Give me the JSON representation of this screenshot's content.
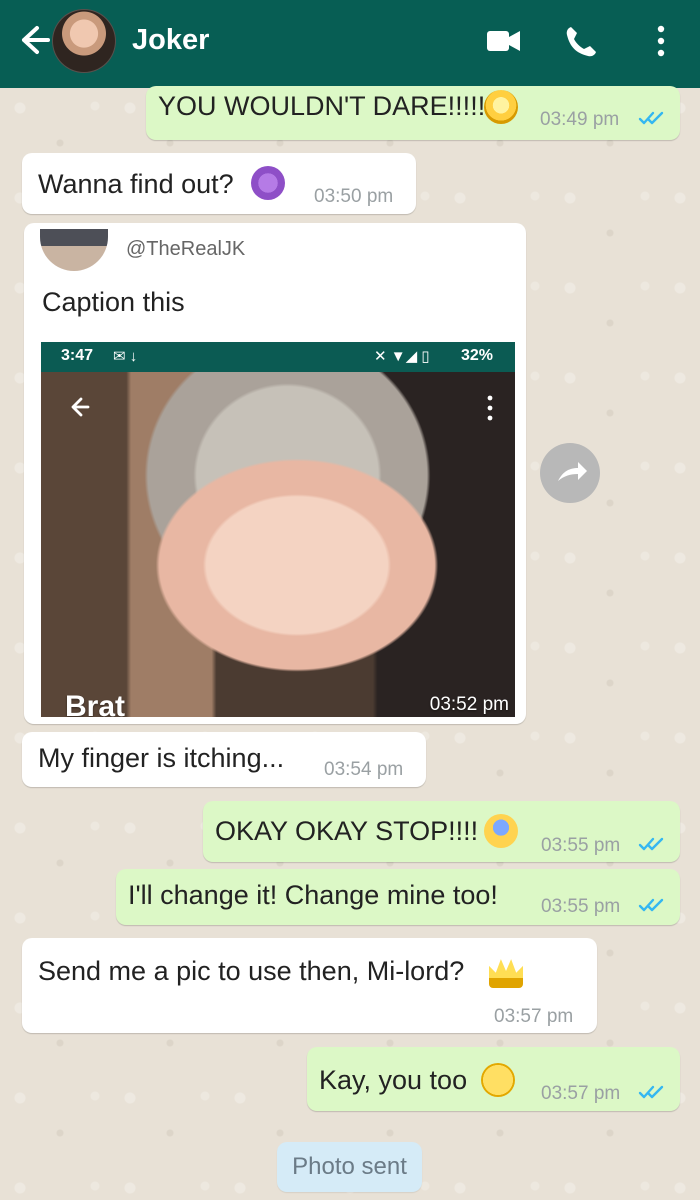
{
  "header": {
    "contact_name": "Joker",
    "back_icon": "back-arrow-icon",
    "video_icon": "video-call-icon",
    "call_icon": "phone-call-icon",
    "menu_icon": "more-options-icon",
    "brand_color": "#075e54"
  },
  "messages": [
    {
      "direction": "outgoing",
      "text": "YOU WOULDN'T DARE!!!!!",
      "emoji": "scream-face",
      "time": "03:49 pm",
      "read_receipt": "double-blue-tick"
    },
    {
      "direction": "incoming",
      "text": "Wanna find out?",
      "emoji": "smiling-devil",
      "time": "03:50 pm"
    },
    {
      "direction": "incoming",
      "type": "tweet-screenshot",
      "handle": "@TheRealJK",
      "caption": "Caption this",
      "status_bar_time": "3:47",
      "status_bar_left_icons": "✉ ↓",
      "status_bar_right": "32%",
      "status_bar_right_icons": "✕ ▼◢ ▯",
      "image_label": "Brat",
      "time": "03:52 pm",
      "forward_icon": "forward-icon"
    },
    {
      "direction": "incoming",
      "text": "My finger is itching...",
      "time": "03:54 pm"
    },
    {
      "direction": "outgoing",
      "text": "OKAY OKAY STOP!!!!",
      "emoji": "anxious-face",
      "time": "03:55 pm",
      "read_receipt": "double-blue-tick"
    },
    {
      "direction": "outgoing",
      "text": "I'll change it! Change mine too!",
      "time": "03:55 pm",
      "read_receipt": "double-blue-tick"
    },
    {
      "direction": "incoming",
      "text": "Send me a pic to use then, Mi-lord?",
      "emoji": "crown",
      "time": "03:57 pm"
    },
    {
      "direction": "outgoing",
      "text": "Kay, you too",
      "emoji": "eye-roll-face",
      "time": "03:57 pm",
      "read_receipt": "double-blue-tick"
    }
  ],
  "system": {
    "photo_sent": "Photo sent"
  },
  "colors": {
    "outgoing_bubble": "#dcf8c6",
    "incoming_bubble": "#ffffff",
    "tick_blue": "#34b7f1",
    "chat_background": "#e8e1d6"
  }
}
